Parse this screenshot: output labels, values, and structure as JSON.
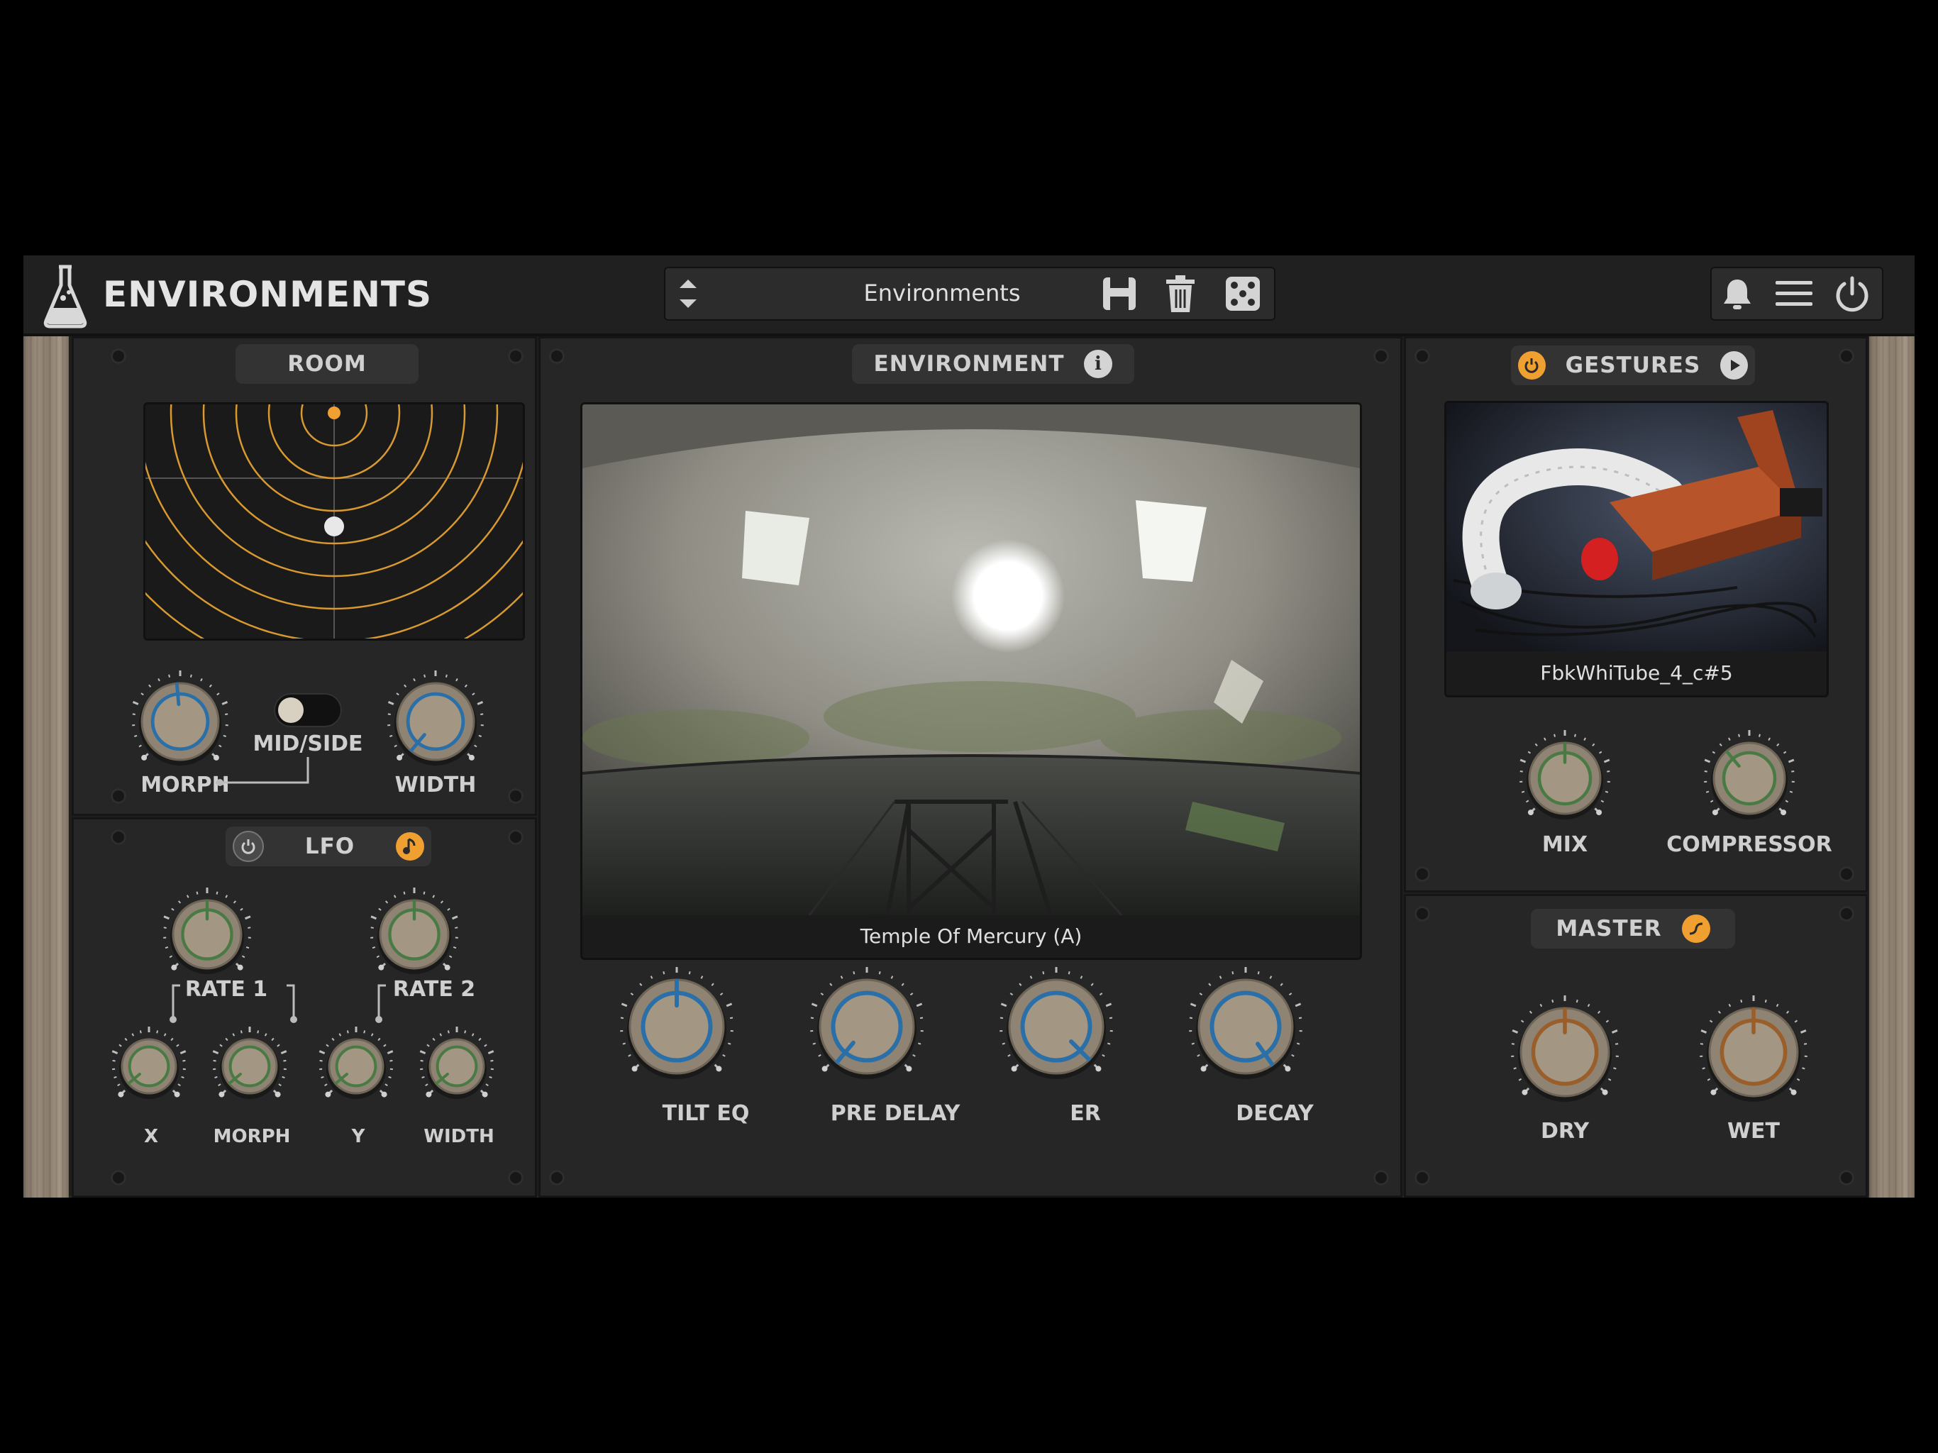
{
  "app": {
    "title": "ENVIRONMENTS"
  },
  "preset": {
    "name": "Environments"
  },
  "header_icons": [
    "prev-next-arrows-icon",
    "save-icon",
    "trash-icon",
    "dice-icon",
    "bell-icon",
    "menu-icon",
    "power-icon"
  ],
  "room": {
    "title": "ROOM",
    "knobs": {
      "morph": "MORPH",
      "width": "WIDTH"
    },
    "toggle_label": "MID/SIDE",
    "toggle_state": "off"
  },
  "lfo": {
    "title": "LFO",
    "rate1": "RATE 1",
    "rate2": "RATE 2",
    "knobs": {
      "x": "X",
      "morph": "MORPH",
      "y": "Y",
      "width": "WIDTH"
    }
  },
  "environment": {
    "title": "ENVIRONMENT",
    "image_caption": "Temple Of Mercury (A)",
    "knobs": {
      "tilt_eq": "TILT EQ",
      "pre_delay": "PRE DELAY",
      "er": "ER",
      "decay": "DECAY"
    }
  },
  "gestures": {
    "title": "GESTURES",
    "image_caption": "FbkWhiTube_4_c#5",
    "knobs": {
      "mix": "MIX",
      "compressor": "COMPRESSOR"
    }
  },
  "master": {
    "title": "MASTER",
    "knobs": {
      "dry": "DRY",
      "wet": "WET"
    }
  },
  "colors": {
    "accent_orange": "#f0a030",
    "ring_blue": "#2a6fa8",
    "ring_green": "#4a7a44",
    "ring_brown": "#9a5e2a",
    "knob_face": "#9d917f"
  }
}
